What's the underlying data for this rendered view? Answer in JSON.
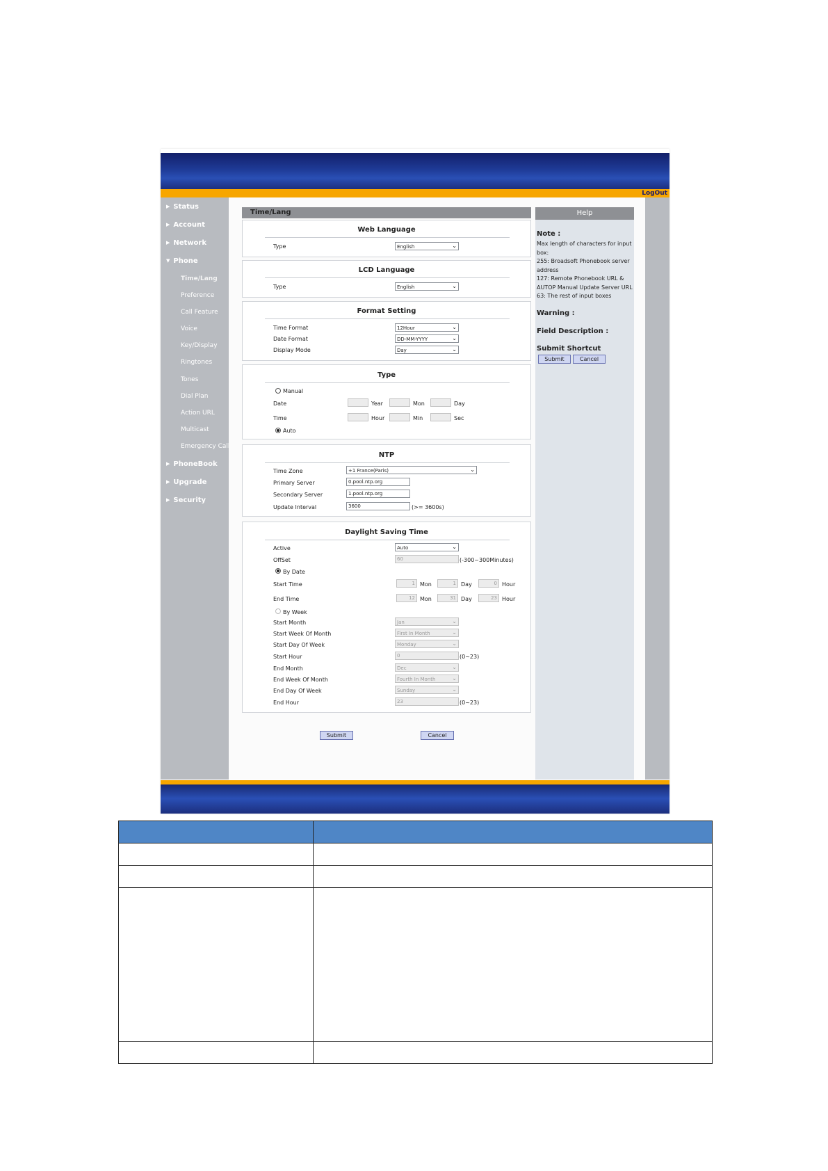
{
  "header": {
    "logout_label": "LogOut"
  },
  "sidebar": {
    "status": "Status",
    "account": "Account",
    "network": "Network",
    "phone": "Phone",
    "phone_items": [
      "Time/Lang",
      "Preference",
      "Call Feature",
      "Voice",
      "Key/Display",
      "Ringtones",
      "Tones",
      "Dial Plan",
      "Action URL",
      "Multicast",
      "Emergency Call"
    ],
    "phonebook": "PhoneBook",
    "upgrade": "Upgrade",
    "security": "Security"
  },
  "page_title": "Time/Lang",
  "web_language": {
    "title": "Web Language",
    "type_label": "Type",
    "type_value": "English"
  },
  "lcd_language": {
    "title": "LCD Language",
    "type_label": "Type",
    "type_value": "English"
  },
  "format_setting": {
    "title": "Format Setting",
    "time_format_label": "Time Format",
    "time_format_value": "12Hour",
    "date_format_label": "Date Format",
    "date_format_value": "DD-MM-YYYY",
    "display_mode_label": "Display Mode",
    "display_mode_value": "Day"
  },
  "type_panel": {
    "title": "Type",
    "manual_label": "Manual",
    "date_label": "Date",
    "year_label": "Year",
    "mon_label": "Mon",
    "day_label": "Day",
    "time_label": "Time",
    "hour_label": "Hour",
    "min_label": "Min",
    "sec_label": "Sec",
    "auto_label": "Auto",
    "selected": "Auto"
  },
  "ntp": {
    "title": "NTP",
    "time_zone_label": "Time Zone",
    "time_zone_value": "+1 France(Paris)",
    "primary_label": "Primary Server",
    "primary_value": "0.pool.ntp.org",
    "secondary_label": "Secondary Server",
    "secondary_value": "1.pool.ntp.org",
    "interval_label": "Update Interval",
    "interval_value": "3600",
    "interval_hint": "(>= 3600s)"
  },
  "dst": {
    "title": "Daylight Saving Time",
    "active_label": "Active",
    "active_value": "Auto",
    "offset_label": "OffSet",
    "offset_value": "60",
    "offset_hint": "(-300~300Minutes)",
    "by_date_label": "By Date",
    "start_time_label": "Start Time",
    "start_mon": "1",
    "start_day": "1",
    "start_hour": "0",
    "end_time_label": "End Time",
    "end_mon": "12",
    "end_day": "31",
    "end_hour": "23",
    "mon_label": "Mon",
    "day_label": "Day",
    "hour_label": "Hour",
    "by_week_label": "By Week",
    "start_month_label": "Start Month",
    "start_month_value": "Jan",
    "start_week_label": "Start Week Of Month",
    "start_week_value": "First In Month",
    "start_dow_label": "Start Day Of Week",
    "start_dow_value": "Monday",
    "start_hour_label": "Start Hour",
    "start_hour_value": "0",
    "hour_hint": "(0~23)",
    "end_month_label": "End Month",
    "end_month_value": "Dec",
    "end_week_label": "End Week Of Month",
    "end_week_value": "Fourth In Month",
    "end_dow_label": "End Day Of Week",
    "end_dow_value": "Sunday",
    "end_hour_label": "End Hour",
    "end_hour_value": "23"
  },
  "actions": {
    "submit": "Submit",
    "cancel": "Cancel"
  },
  "help": {
    "title": "Help",
    "note_label": "Note :",
    "note_lines": [
      "Max length of characters for input",
      "box:",
      "255: Broadsoft Phonebook server",
      "address",
      "127: Remote Phonebook URL &",
      "AUTOP Manual Update Server URL",
      "63: The rest of input boxes"
    ],
    "warning_label": "Warning :",
    "field_desc_label": "Field Description :",
    "submit_shortcut_label": "Submit Shortcut",
    "submit": "Submit",
    "cancel": "Cancel"
  },
  "colors": {
    "banner": "#1e3a96",
    "accent": "#f7a600",
    "sidebar": "#b8bbc0",
    "table_header": "#4f86c6"
  }
}
